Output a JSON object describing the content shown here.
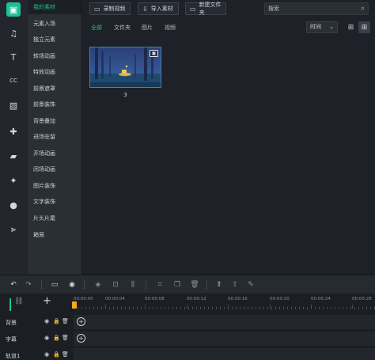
{
  "rail": {
    "items": [
      {
        "name": "media-icon",
        "glyph": "▣",
        "active": true
      },
      {
        "name": "music-icon",
        "glyph": "♫",
        "active": false
      },
      {
        "name": "text-icon",
        "glyph": "T",
        "active": false
      },
      {
        "name": "caption-icon",
        "glyph": "CC",
        "active": false
      },
      {
        "name": "filter-icon",
        "glyph": "▧",
        "active": false
      },
      {
        "name": "plugin-icon",
        "glyph": "✚",
        "active": false
      },
      {
        "name": "folder-icon",
        "glyph": "▰",
        "active": false
      },
      {
        "name": "magic-wand-icon",
        "glyph": "✦",
        "active": false
      },
      {
        "name": "person-icon",
        "glyph": "●",
        "active": false
      },
      {
        "name": "split-icon",
        "glyph": "⫸",
        "active": false
      }
    ]
  },
  "menu": {
    "items": [
      "我的素材",
      "元素入场",
      "独立元素",
      "转场动画",
      "特效动画",
      "前景遮罩",
      "前景装饰",
      "背景叠加",
      "进场驻留",
      "开场动画",
      "闭场动画",
      "图片装饰",
      "文字装饰",
      "片头片尾",
      "箱笼"
    ]
  },
  "toolbar_top": {
    "record_label": "录制视频",
    "import_label": "导入素材",
    "new_folder_label": "新建文件夹",
    "search_placeholder": "搜索"
  },
  "filter_tabs": [
    "全部",
    "文件夹",
    "图片",
    "视频"
  ],
  "sort": {
    "label": "时间"
  },
  "media_items": [
    {
      "label": "3"
    }
  ],
  "timeline": {
    "ticks": [
      "00:00:00",
      "00:00:04",
      "00:00:08",
      "00:00:12",
      "00:00:16",
      "00:00:20",
      "00:00:24",
      "00:00:28"
    ],
    "tracks": [
      {
        "label": "背景"
      },
      {
        "label": "字幕"
      },
      {
        "label": "轨道1"
      }
    ]
  },
  "colors": {
    "accent": "#1fbf95",
    "playhead": "#f5a623",
    "bg": "#1e2127"
  }
}
